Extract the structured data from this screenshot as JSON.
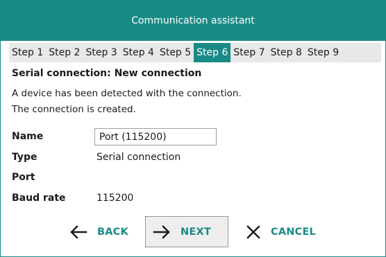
{
  "window": {
    "title": "Communication assistant"
  },
  "steps": [
    {
      "label": "Step 1",
      "active": false
    },
    {
      "label": "Step 2",
      "active": false
    },
    {
      "label": "Step 3",
      "active": false
    },
    {
      "label": "Step 4",
      "active": false
    },
    {
      "label": "Step 5",
      "active": false
    },
    {
      "label": "Step 6",
      "active": true
    },
    {
      "label": "Step 7",
      "active": false
    },
    {
      "label": "Step 8",
      "active": false
    },
    {
      "label": "Step 9",
      "active": false
    }
  ],
  "section": {
    "title": "Serial connection: New connection",
    "message_line1": "A device has been detected with the connection.",
    "message_line2": "The connection is created."
  },
  "fields": {
    "name_label": "Name",
    "name_value": "Port (115200)",
    "type_label": "Type",
    "type_value": "Serial connection",
    "port_label": "Port",
    "port_value": "",
    "baud_label": "Baud rate",
    "baud_value": "115200"
  },
  "buttons": {
    "back_label": "BACK",
    "back_icon": "arrow-left-icon",
    "next_label": "NEXT",
    "next_icon": "arrow-right-icon",
    "cancel_label": "CANCEL",
    "cancel_icon": "close-icon"
  },
  "colors": {
    "accent": "#1a8a86",
    "step_bar": "#e8e8e8",
    "text": "#1a1a1a"
  }
}
